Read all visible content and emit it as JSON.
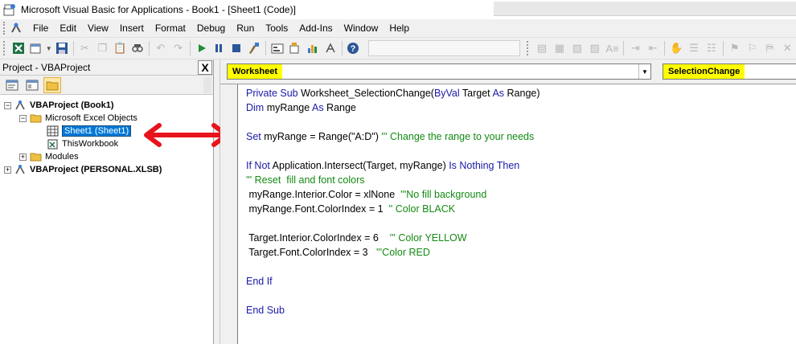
{
  "window": {
    "title": "Microsoft Visual Basic for Applications - Book1 - [Sheet1 (Code)]"
  },
  "menu": {
    "items": [
      "File",
      "Edit",
      "View",
      "Insert",
      "Format",
      "Debug",
      "Run",
      "Tools",
      "Add-Ins",
      "Window",
      "Help"
    ]
  },
  "project": {
    "header": "Project - VBAProject",
    "close_glyph": "X",
    "tree": {
      "vba_book1": "VBAProject (Book1)",
      "excel_objects": "Microsoft Excel Objects",
      "sheet1": "Sheet1 (Sheet1)",
      "thisworkbook": "ThisWorkbook",
      "modules": "Modules",
      "vba_personal": "VBAProject (PERSONAL.XLSB)"
    }
  },
  "code": {
    "object_combo": "Worksheet",
    "procedure_combo": "SelectionChange",
    "lines": [
      [
        {
          "t": "Private Sub ",
          "c": "kw"
        },
        {
          "t": "Worksheet_SelectionChange(",
          "c": ""
        },
        {
          "t": "ByVal",
          "c": "kw"
        },
        {
          "t": " Target ",
          "c": ""
        },
        {
          "t": "As",
          "c": "kw"
        },
        {
          "t": " Range)",
          "c": ""
        }
      ],
      [
        {
          "t": "Dim",
          "c": "kw"
        },
        {
          "t": " myRange ",
          "c": ""
        },
        {
          "t": "As",
          "c": "kw"
        },
        {
          "t": " Range",
          "c": ""
        }
      ],
      [],
      [
        {
          "t": "Set",
          "c": "kw"
        },
        {
          "t": " myRange = Range(\"A:D\") ",
          "c": ""
        },
        {
          "t": "''' Change the range to your needs",
          "c": "cm"
        }
      ],
      [],
      [
        {
          "t": "If Not",
          "c": "kw"
        },
        {
          "t": " Application.Intersect(Target, myRange) ",
          "c": ""
        },
        {
          "t": "Is Nothing Then",
          "c": "kw"
        }
      ],
      [
        {
          "t": "''' Reset  fill and font colors",
          "c": "cm"
        }
      ],
      [
        {
          "t": " myRange.Interior.Color = xlNone  ",
          "c": ""
        },
        {
          "t": "'''No fill background",
          "c": "cm"
        }
      ],
      [
        {
          "t": " myRange.Font.ColorIndex = 1  ",
          "c": ""
        },
        {
          "t": "'' Color BLACK",
          "c": "cm"
        }
      ],
      [],
      [
        {
          "t": " Target.Interior.ColorIndex = 6    ",
          "c": ""
        },
        {
          "t": "''' Color YELLOW",
          "c": "cm"
        }
      ],
      [
        {
          "t": " Target.Font.ColorIndex = 3   ",
          "c": ""
        },
        {
          "t": "'''Color RED",
          "c": "cm"
        }
      ],
      [],
      [
        {
          "t": "End If",
          "c": "kw"
        }
      ],
      [],
      [
        {
          "t": "End Sub",
          "c": "kw"
        }
      ]
    ]
  },
  "colors": {
    "keyword": "#1a1aa6",
    "comment": "#138a13",
    "highlight": "#ffff00",
    "arrow": "#e8141c",
    "selection": "#0078d7"
  },
  "icons": {
    "toolbar": [
      "excel-icon",
      "insert-userform-icon",
      "save-icon",
      "cut-icon",
      "copy-icon",
      "paste-icon",
      "find-icon",
      "undo-icon",
      "redo-icon",
      "run-icon",
      "break-icon",
      "reset-icon",
      "design-mode-icon",
      "project-explorer-icon",
      "properties-icon",
      "object-browser-icon",
      "toolbox-icon",
      "help-icon"
    ]
  }
}
